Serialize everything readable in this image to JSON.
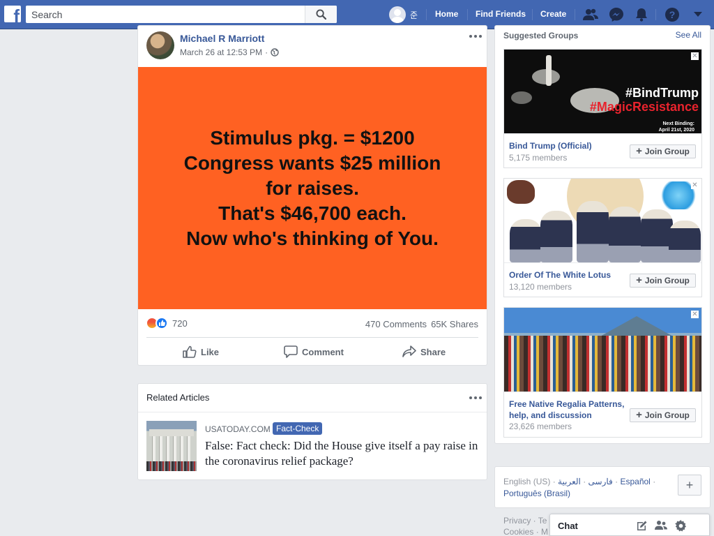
{
  "topbar": {
    "logo": "f",
    "search_placeholder": "Search",
    "user_name": "준",
    "links": {
      "home": "Home",
      "find_friends": "Find Friends",
      "create": "Create"
    }
  },
  "post": {
    "author": "Michael R Marriott",
    "timestamp": "March 26 at 12:53 PM",
    "meta_sep": "·",
    "image_lines": [
      "Stimulus pkg. = $1200",
      "Congress wants $25 million",
      "for raises.",
      "That's $46,700 each.",
      "Now who's thinking of You."
    ],
    "reaction_count": "720",
    "comments": "470 Comments",
    "shares": "65K Shares",
    "actions": {
      "like": "Like",
      "comment": "Comment",
      "share": "Share"
    }
  },
  "related": {
    "title": "Related Articles",
    "source": "USATODAY.COM",
    "badge": "Fact-Check",
    "headline": "False: Fact check: Did the House give itself a pay raise in the coronavirus relief package?"
  },
  "suggested_groups": {
    "title": "Suggested Groups",
    "see_all": "See All",
    "join_label": "Join Group",
    "groups": [
      {
        "name": "Bind Trump (Official)",
        "members": "5,175 members",
        "image_text": [
          "#BindTrump",
          "#MagicResistance"
        ],
        "image_small": [
          "Next Binding:",
          "April 21st, 2020"
        ]
      },
      {
        "name": "Order Of The White Lotus",
        "members": "13,120 members"
      },
      {
        "name": "Free Native Regalia Patterns, help, and discussion",
        "members": "23,626 members"
      }
    ]
  },
  "languages": {
    "current": "English (US)",
    "sep": "·",
    "others": [
      "فارسی",
      "العربية",
      "Español",
      "Português (Brasil)"
    ],
    "add": "+"
  },
  "footer": {
    "line1": "Privacy · Te",
    "line2": "Cookies · M"
  },
  "chat": {
    "label": "Chat"
  },
  "colors": {
    "brand": "#4267b2",
    "image_bg": "#ff6122",
    "link": "#385898"
  }
}
